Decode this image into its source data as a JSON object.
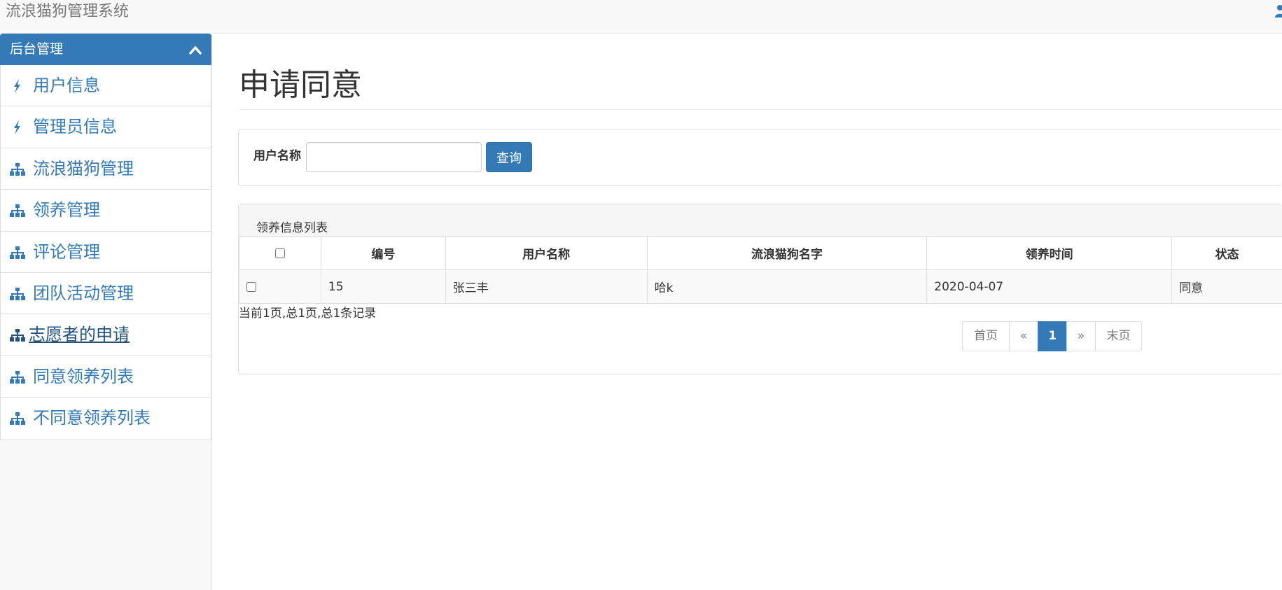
{
  "app": {
    "title": "流浪猫狗管理系统"
  },
  "sidebar": {
    "heading": "后台管理",
    "items": [
      {
        "label": "用户信息",
        "icon": "bolt-icon"
      },
      {
        "label": "管理员信息",
        "icon": "bolt-icon"
      },
      {
        "label": "流浪猫狗管理",
        "icon": "sitemap-icon"
      },
      {
        "label": "领养管理",
        "icon": "sitemap-icon"
      },
      {
        "label": "评论管理",
        "icon": "sitemap-icon"
      },
      {
        "label": "团队活动管理",
        "icon": "sitemap-icon"
      },
      {
        "label": "志愿者的申请",
        "icon": "sitemap-icon",
        "active": true
      },
      {
        "label": "同意领养列表",
        "icon": "sitemap-icon"
      },
      {
        "label": "不同意领养列表",
        "icon": "sitemap-icon"
      }
    ]
  },
  "main": {
    "title": "申请同意",
    "search": {
      "label": "用户名称",
      "value": "",
      "button": "查询"
    },
    "list": {
      "title": "领养信息列表",
      "columns": [
        "编号",
        "用户名称",
        "流浪猫狗名字",
        "领养时间",
        "状态"
      ],
      "rows": [
        {
          "id": "15",
          "user": "张三丰",
          "pet": "哈k",
          "date": "2020-04-07",
          "status": "同意"
        }
      ]
    },
    "pagination": {
      "info": "当前1页,总1页,总1条记录",
      "first": "首页",
      "prev": "«",
      "current": "1",
      "next": "»",
      "last": "末页"
    }
  },
  "colors": {
    "primary": "#337ab7",
    "link": "#337ab7",
    "navbar_bg": "#f8f8f8"
  }
}
